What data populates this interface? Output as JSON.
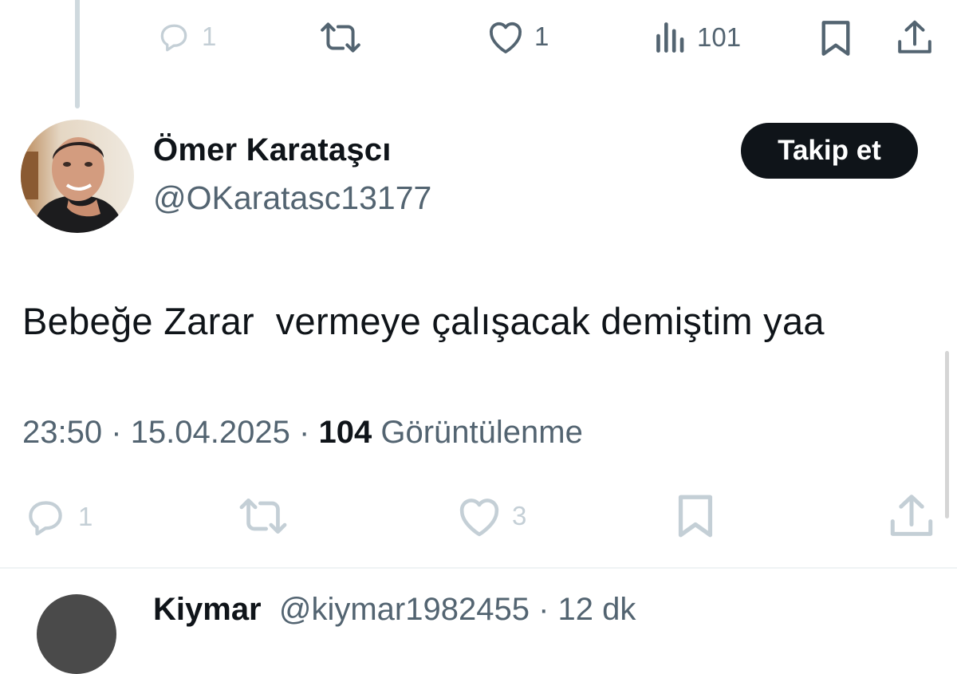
{
  "previous_tweet": {
    "actions": {
      "reply_count": "1",
      "retweet_count": "",
      "like_count": "1",
      "views_count": "101"
    }
  },
  "tweet": {
    "author": {
      "name": "Ömer Karataşcı",
      "handle": "@OKaratasc13177"
    },
    "follow_label": "Takip et",
    "text": "Bebeğe Zarar  vermeye çalışacak demiştim yaa",
    "time": "23:50",
    "date": "15.04.2025",
    "separator": "·",
    "views_number": "104",
    "views_label": "Görüntülenme",
    "actions": {
      "reply_count": "1",
      "like_count": "3"
    }
  },
  "next_reply": {
    "name": "Kiymar",
    "handle_partial": "@kiymar1982455",
    "time_partial": "12 dk"
  },
  "icons": {
    "reply": "reply-icon",
    "retweet": "retweet-icon",
    "like": "like-icon",
    "views": "views-icon",
    "bookmark": "bookmark-icon",
    "share": "share-icon"
  },
  "colors": {
    "text": "#0f1419",
    "secondary": "#536471",
    "muted": "#c4cfd6",
    "button_bg": "#0f1419"
  }
}
